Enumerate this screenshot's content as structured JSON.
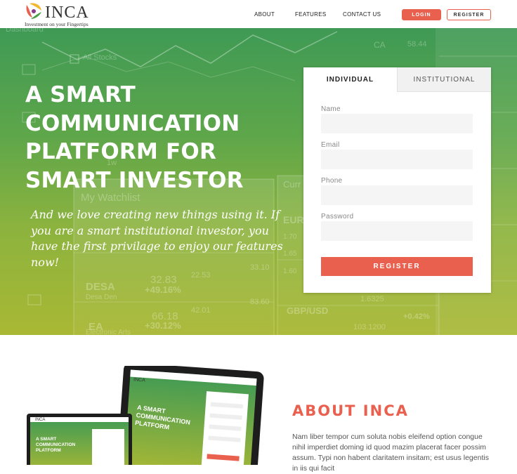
{
  "brand": {
    "name": "INCA",
    "tagline": "Investment on your Fingertips"
  },
  "nav": {
    "links": [
      "ABOUT",
      "FEATURES",
      "CONTACT US"
    ],
    "login_label": "LOGIN",
    "register_label": "REGISTER"
  },
  "hero": {
    "title": "A SMART COMMUNICATION PLATFORM FOR SMART INVESTOR",
    "subtitle": "And we love creating new things using it. If you are a smart institutional investor, you have the first privilage to enjoy our features now!",
    "background_text": {
      "dashboard": "Dashboard",
      "all_stocks": "All Stocks",
      "watchlist": "My Watchlist",
      "curr": "Curr",
      "eur": "EUR",
      "desa": "DESA",
      "desa_sub": "Desa Den",
      "desa_price": "32.83",
      "desa_change": "+49.16%",
      "ea": "EA",
      "ea_sub": "Electronic Arts",
      "ea_price": "66.18",
      "ea_change": "+30.12%",
      "gbpusd": "GBP/USD",
      "rate1": "1.6325",
      "rate2": "103.1200",
      "ca": "CA",
      "pct": "+0.42%",
      "nums": [
        "22.53",
        "33.10",
        "42.01",
        "83.60",
        "1.70",
        "1.65",
        "1.60",
        "58.44"
      ],
      "one_w": "1w"
    }
  },
  "form": {
    "tabs": [
      "INDIVIDUAL",
      "INSTITUTIONAL"
    ],
    "active_tab": "INDIVIDUAL",
    "fields": [
      {
        "label": "Name",
        "value": ""
      },
      {
        "label": "Email",
        "value": ""
      },
      {
        "label": "Phone",
        "value": ""
      },
      {
        "label": "Password",
        "value": ""
      }
    ],
    "submit_label": "REGISTER"
  },
  "about": {
    "title": "ABOUT INCA",
    "text": "Nam liber tempor cum soluta nobis eleifend option congue nihil imperdiet doming id quod mazim placerat facer possim assum. Typi non habent claritatem insitam; est usus legentis in iis qui facit"
  },
  "mockup": {
    "brand": "INCA",
    "title": "A SMART COMMUNICATION PLATFORM"
  },
  "colors": {
    "accent": "#e9604f",
    "hero_green": "#4fa152",
    "hero_olive": "#a9b834"
  }
}
